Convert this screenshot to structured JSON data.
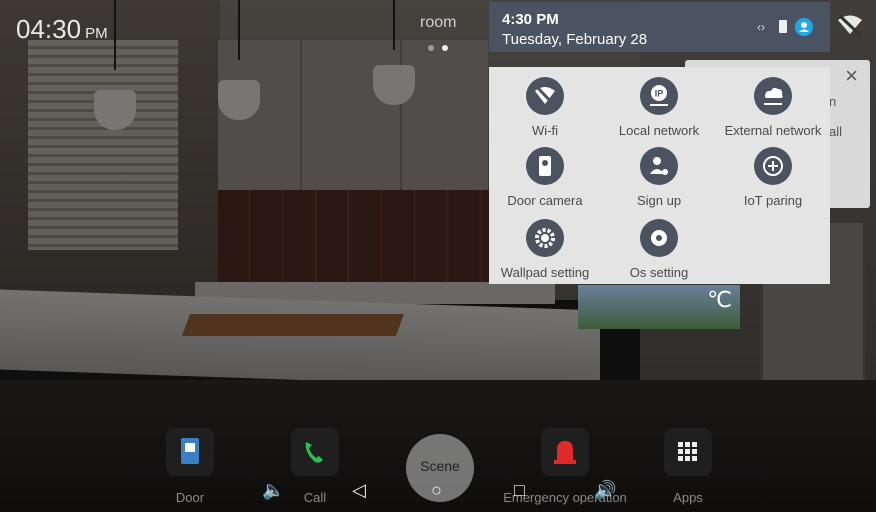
{
  "top": {
    "clock_time": "04:30",
    "clock_ampm": "PM",
    "room_label": "room"
  },
  "status": {
    "time": "4:30 PM",
    "date": "Tuesday, February 28",
    "icons": [
      "code-icon",
      "battery-icon",
      "account-icon"
    ]
  },
  "quick_settings": {
    "items": [
      {
        "label": "Wi-fi",
        "icon": "wifi-off-icon"
      },
      {
        "label": "Local network",
        "icon": "ip-icon"
      },
      {
        "label": "External network",
        "icon": "cloud-network-icon"
      },
      {
        "label": "Door camera",
        "icon": "door-camera-icon"
      },
      {
        "label": "Sign up",
        "icon": "user-add-icon"
      },
      {
        "label": "IoT paring",
        "icon": "plus-circle-icon"
      },
      {
        "label": "Wallpad setting",
        "icon": "gear-icon"
      },
      {
        "label": "Os setting",
        "icon": "gear-icon"
      }
    ]
  },
  "dialog": {
    "close": "×",
    "text1": "n",
    "text2": "all"
  },
  "weather": {
    "unit": "℃"
  },
  "dock": {
    "items": [
      {
        "label": "Door",
        "icon": "door-icon"
      },
      {
        "label": "Call",
        "icon": "phone-icon"
      },
      {
        "label": "Scene",
        "icon": "scene-icon"
      },
      {
        "label": "Emergency operation",
        "icon": "alarm-icon"
      },
      {
        "label": "Apps",
        "icon": "apps-grid-icon"
      }
    ]
  },
  "nav": {
    "vol_down": "🔈",
    "back": "◁",
    "home": "○",
    "recent": "□",
    "vol_up": "🔊"
  },
  "colors": {
    "status_bar": "#4a5361",
    "panel_bg": "#e4e4e4",
    "icon_circle": "#4b5260",
    "account": "#1fa8e6",
    "phone_green": "#2bbf4d",
    "alarm_red": "#e02a2a",
    "door_blue": "#3b7fc4"
  }
}
